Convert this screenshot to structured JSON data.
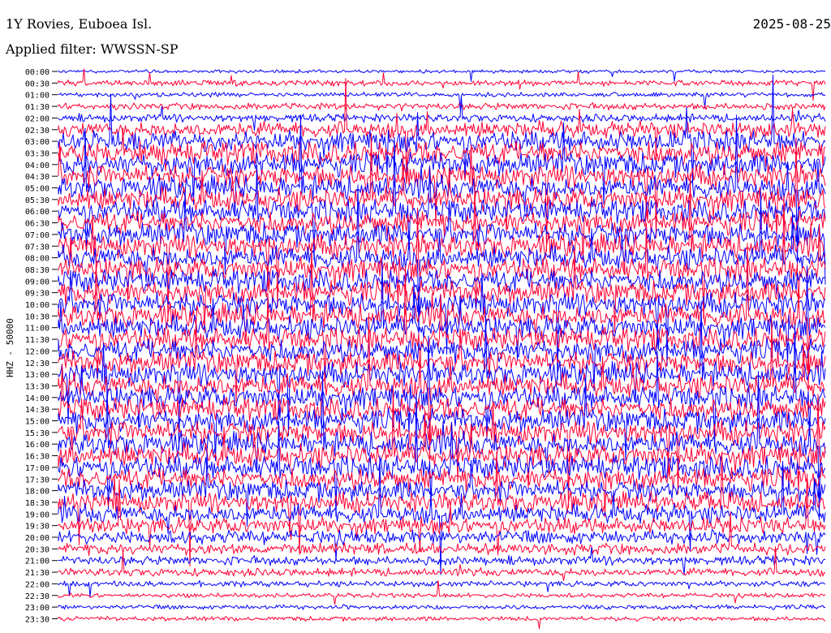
{
  "chart_data": {
    "type": "line",
    "title": "1Y Rovies, Euboea Isl.",
    "subtitle": "Applied filter: WWSSN-SP",
    "date": "2025-08-25",
    "ylabel": "HHZ - 50000",
    "xlabel": "",
    "tick_labels": [
      "00:00",
      "00:30",
      "01:00",
      "01:30",
      "02:00",
      "02:30",
      "03:00",
      "03:30",
      "04:00",
      "04:30",
      "05:00",
      "05:30",
      "06:00",
      "06:30",
      "07:00",
      "07:30",
      "08:00",
      "08:30",
      "09:00",
      "09:30",
      "10:00",
      "10:30",
      "11:00",
      "11:30",
      "12:00",
      "12:30",
      "13:00",
      "13:30",
      "14:00",
      "14:30",
      "15:00",
      "15:30",
      "16:00",
      "16:30",
      "17:00",
      "17:30",
      "18:00",
      "18:30",
      "19:00",
      "19:30",
      "20:00",
      "20:30",
      "21:00",
      "21:30",
      "22:00",
      "22:30",
      "23:00",
      "23:30"
    ],
    "trace_colors": [
      "#0000ff",
      "#ff0033"
    ],
    "trace_amplitude_level": [
      0.15,
      0.25,
      0.2,
      0.3,
      0.35,
      0.7,
      0.9,
      1,
      1,
      1,
      1,
      1,
      1,
      1,
      1,
      1,
      1,
      1,
      1,
      1,
      1,
      1,
      1,
      1,
      1,
      1,
      1,
      1,
      1,
      1,
      1,
      1,
      1,
      1,
      1,
      0.95,
      0.9,
      0.85,
      0.8,
      0.7,
      0.6,
      0.5,
      0.4,
      0.35,
      0.25,
      0.2,
      0.2,
      0.2
    ]
  }
}
